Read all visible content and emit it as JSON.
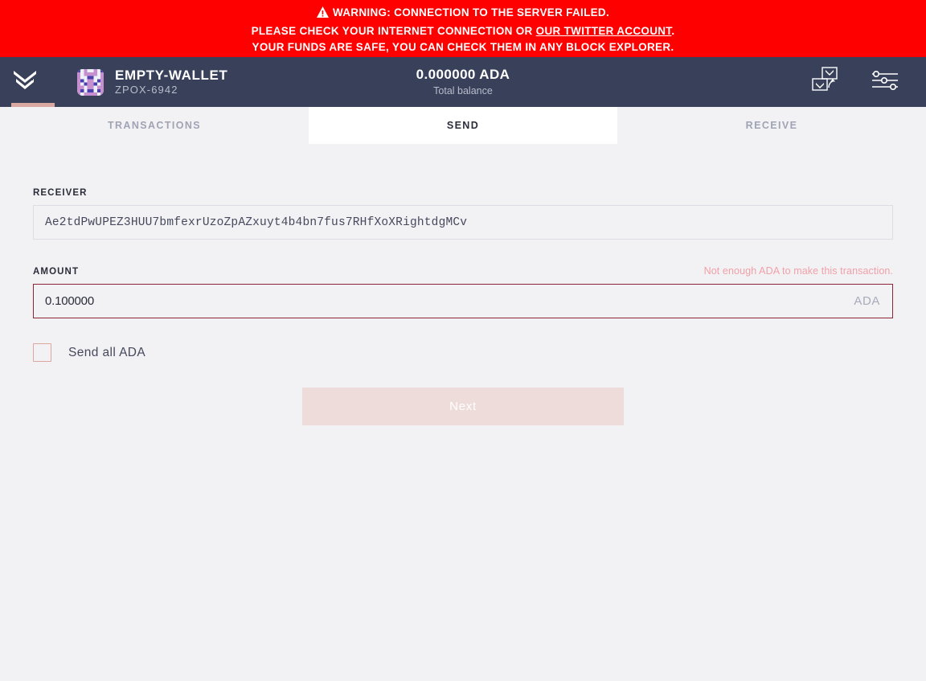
{
  "warning_banner": {
    "icon": "warning-triangle-icon",
    "line1": "WARNING: CONNECTION TO THE SERVER FAILED.",
    "line2_prefix": "PLEASE CHECK YOUR INTERNET CONNECTION OR ",
    "line2_link": "OUR TWITTER ACCOUNT",
    "line2_suffix": ".",
    "line3": "YOUR FUNDS ARE SAFE, YOU CAN CHECK THEM IN ANY BLOCK EXPLORER.",
    "background_color": "#ff0000",
    "text_color": "#ffffff"
  },
  "topbar": {
    "logo_icon": "yoroi-chevron-logo-icon",
    "accent_color": "#d9a8a1",
    "background_color": "#38405a",
    "wallet": {
      "avatar_icon": "wallet-identicon-avatar",
      "name": "EMPTY-WALLET",
      "id": "ZPOX-6942"
    },
    "balance": {
      "amount": "0.000000 ADA",
      "label": "Total balance"
    },
    "actions": [
      {
        "icon": "wallet-switch-icon",
        "name": "switch-wallet-button"
      },
      {
        "icon": "settings-sliders-icon",
        "name": "settings-button"
      }
    ]
  },
  "tabs": [
    {
      "label": "TRANSACTIONS",
      "active": false
    },
    {
      "label": "SEND",
      "active": true
    },
    {
      "label": "RECEIVE",
      "active": false
    }
  ],
  "send_form": {
    "receiver": {
      "label": "RECEIVER",
      "value": "Ae2tdPwUPEZ3HUU7bmfexrUzoZpAZxuyt4b4bn7fus7RHfXoXRightdgMCv",
      "placeholder": ""
    },
    "amount": {
      "label": "AMOUNT",
      "value": "0.100000",
      "placeholder": "",
      "suffix": "ADA",
      "error": "Not enough ADA to make this transaction.",
      "error_color": "#f2a0a8",
      "border_color": "#8d2438"
    },
    "send_all": {
      "label": "Send all ADA",
      "checked": false
    },
    "next_button": {
      "label": "Next",
      "disabled": true,
      "background_color": "#eedcda"
    }
  }
}
